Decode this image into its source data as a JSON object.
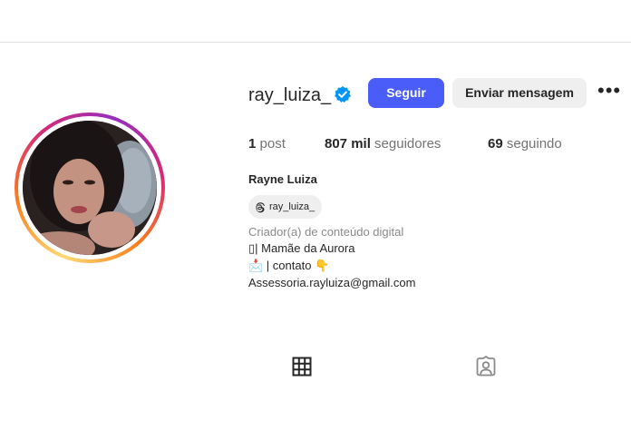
{
  "profile": {
    "username": "ray_luiza_",
    "full_name": "Rayne Luiza",
    "verified": true
  },
  "actions": {
    "follow_label": "Seguir",
    "message_label": "Enviar mensagem",
    "more_label": "•••"
  },
  "stats": {
    "posts_value": "1",
    "posts_label": "post",
    "followers_value": "807 mil",
    "followers_label": "seguidores",
    "following_value": "69",
    "following_label": "seguindo"
  },
  "threads": {
    "handle": "ray_luiza_",
    "icon": "threads-icon"
  },
  "bio": {
    "category": "Criador(a) de conteúdo digital",
    "line1": "▯| Mamãe da Aurora",
    "line2": "📩 | contato 👇",
    "line3": "Assessoria.rayluiza@gmail.com"
  },
  "tabs": {
    "posts_icon": "grid-icon",
    "tagged_icon": "tagged-icon"
  },
  "colors": {
    "follow_button": "#4a5df9",
    "message_button": "#efefef",
    "verified_badge": "#0095f6",
    "secondary_text": "#737373"
  }
}
